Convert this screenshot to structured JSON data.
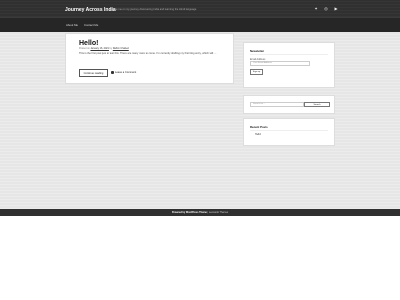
{
  "site": {
    "title": "Journey Across India",
    "description": "Follow me on my journey discovering India and learning the Hindi language"
  },
  "social": [
    "twitter-icon",
    "instagram-icon",
    "youtube-icon"
  ],
  "nav": [
    "About Me",
    "Contact Me"
  ],
  "post": {
    "title": "Hello!",
    "meta_prefix": "Posted on",
    "date": "January 16, 2021",
    "meta_by": "by",
    "author": "Rahim Chabed",
    "excerpt": "This is the first post just to test this. There are many more to come. I'm currently drafting my first blog entry, which will …",
    "continue_label": "Continue reading",
    "comment_label": "Leave a Comment"
  },
  "newsletter": {
    "title": "Newsletter",
    "email_label": "Email Address",
    "email_placeholder": "Your Email Address",
    "signup_label": "Sign up"
  },
  "search": {
    "placeholder": "Search for…",
    "button_label": "Search"
  },
  "recent_posts": {
    "title": "Recent Posts",
    "items": [
      "Hello!"
    ]
  },
  "footer": {
    "prefix": "Powered by",
    "brand": "WordPress Theme",
    "rest": "| Leonardo Themes"
  }
}
